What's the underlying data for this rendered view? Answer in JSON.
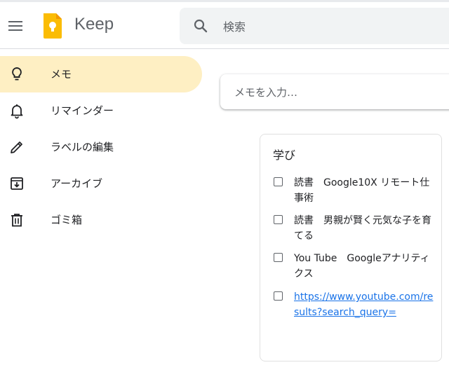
{
  "header": {
    "app_title": "Keep",
    "search_placeholder": "検索"
  },
  "sidebar": {
    "items": [
      {
        "label": "メモ",
        "icon": "lightbulb-icon",
        "active": true
      },
      {
        "label": "リマインダー",
        "icon": "bell-icon",
        "active": false
      },
      {
        "label": "ラベルの編集",
        "icon": "pencil-icon",
        "active": false
      },
      {
        "label": "アーカイブ",
        "icon": "archive-icon",
        "active": false
      },
      {
        "label": "ゴミ箱",
        "icon": "trash-icon",
        "active": false
      }
    ]
  },
  "main": {
    "take_note_placeholder": "メモを入力…",
    "note": {
      "title": "学び",
      "items": [
        {
          "text": "読書　Google10X リモート仕事術",
          "checked": false
        },
        {
          "text": "読書　男親が賢く元気な子を育てる",
          "checked": false
        },
        {
          "text": "You Tube　Googleアナリティクス",
          "checked": false
        },
        {
          "text": "https://www.youtube.com/results?search_query=",
          "checked": false,
          "is_link": true
        }
      ]
    }
  },
  "colors": {
    "active_nav_bg": "#feefc3",
    "search_bg": "#f1f3f4",
    "logo_yellow": "#fbbc04",
    "link": "#1a73e8"
  }
}
